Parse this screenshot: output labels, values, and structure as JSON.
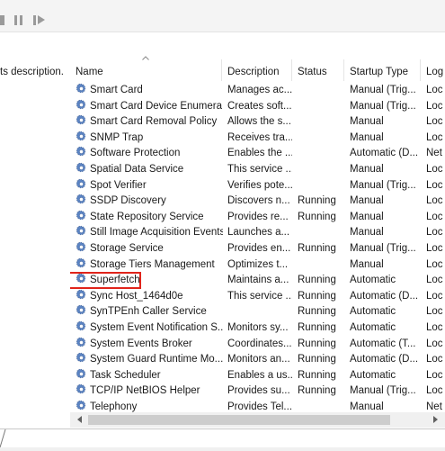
{
  "description_pane": {
    "text": "ts description."
  },
  "toolbar": {
    "stop_icon": "stop-icon",
    "pause_icon": "pause-icon",
    "restart_icon": "restart-icon"
  },
  "columns": [
    {
      "label": "Name",
      "sorted": "ascending"
    },
    {
      "label": "Description"
    },
    {
      "label": "Status"
    },
    {
      "label": "Startup Type"
    },
    {
      "label": "Log"
    }
  ],
  "services": [
    {
      "name": "Smart Card",
      "description": "Manages ac...",
      "status": "",
      "startup": "Manual (Trig...",
      "log": "Loc"
    },
    {
      "name": "Smart Card Device Enumera...",
      "description": "Creates soft...",
      "status": "",
      "startup": "Manual (Trig...",
      "log": "Loc"
    },
    {
      "name": "Smart Card Removal Policy",
      "description": "Allows the s...",
      "status": "",
      "startup": "Manual",
      "log": "Loc"
    },
    {
      "name": "SNMP Trap",
      "description": "Receives tra...",
      "status": "",
      "startup": "Manual",
      "log": "Loc"
    },
    {
      "name": "Software Protection",
      "description": "Enables the ...",
      "status": "",
      "startup": "Automatic (D...",
      "log": "Net"
    },
    {
      "name": "Spatial Data Service",
      "description": "This service ...",
      "status": "",
      "startup": "Manual",
      "log": "Loc"
    },
    {
      "name": "Spot Verifier",
      "description": "Verifies pote...",
      "status": "",
      "startup": "Manual (Trig...",
      "log": "Loc"
    },
    {
      "name": "SSDP Discovery",
      "description": "Discovers n...",
      "status": "Running",
      "startup": "Manual",
      "log": "Loc"
    },
    {
      "name": "State Repository Service",
      "description": "Provides re...",
      "status": "Running",
      "startup": "Manual",
      "log": "Loc"
    },
    {
      "name": "Still Image Acquisition Events",
      "description": "Launches a...",
      "status": "",
      "startup": "Manual",
      "log": "Loc"
    },
    {
      "name": "Storage Service",
      "description": "Provides en...",
      "status": "Running",
      "startup": "Manual (Trig...",
      "log": "Loc"
    },
    {
      "name": "Storage Tiers Management",
      "description": "Optimizes t...",
      "status": "",
      "startup": "Manual",
      "log": "Loc"
    },
    {
      "name": "Superfetch",
      "description": "Maintains a...",
      "status": "Running",
      "startup": "Automatic",
      "log": "Loc",
      "highlighted": true
    },
    {
      "name": "Sync Host_1464d0e",
      "description": "This service ...",
      "status": "Running",
      "startup": "Automatic (D...",
      "log": "Loc"
    },
    {
      "name": "SynTPEnh Caller Service",
      "description": "",
      "status": "Running",
      "startup": "Automatic",
      "log": "Loc"
    },
    {
      "name": "System Event Notification S...",
      "description": "Monitors sy...",
      "status": "Running",
      "startup": "Automatic",
      "log": "Loc"
    },
    {
      "name": "System Events Broker",
      "description": "Coordinates...",
      "status": "Running",
      "startup": "Automatic (T...",
      "log": "Loc"
    },
    {
      "name": "System Guard Runtime Mo...",
      "description": "Monitors an...",
      "status": "Running",
      "startup": "Automatic (D...",
      "log": "Loc"
    },
    {
      "name": "Task Scheduler",
      "description": "Enables a us...",
      "status": "Running",
      "startup": "Automatic",
      "log": "Loc"
    },
    {
      "name": "TCP/IP NetBIOS Helper",
      "description": "Provides su...",
      "status": "Running",
      "startup": "Manual (Trig...",
      "log": "Loc"
    },
    {
      "name": "Telephony",
      "description": "Provides Tel...",
      "status": "",
      "startup": "Manual",
      "log": "Net"
    }
  ],
  "colors": {
    "highlight_box": "#e0241b",
    "gear_blue": "#5b84c4"
  },
  "icons": {
    "service": "gear-icon",
    "sort": "sort-ascending-icon"
  }
}
